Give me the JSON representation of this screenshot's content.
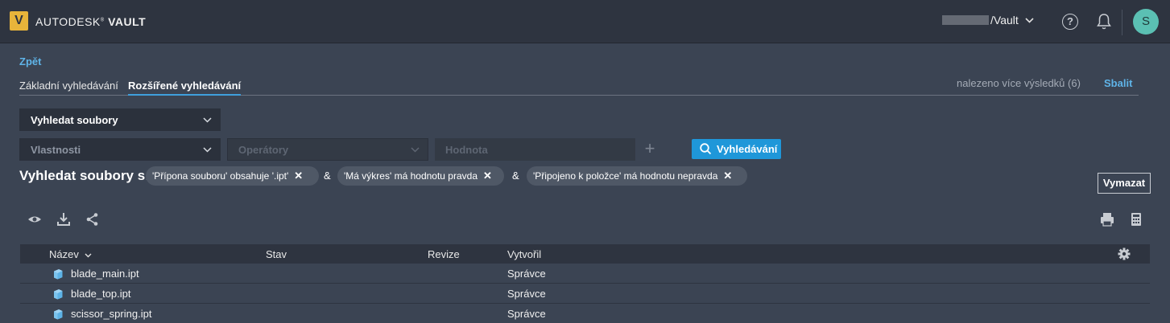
{
  "topbar": {
    "logo_letter": "V",
    "brand_prefix": "AUTODESK",
    "brand_name": "VAULT",
    "vault_name": "/Vault",
    "help_icon": "help-circle-icon",
    "bell_icon": "bell-icon",
    "user_initial": "S",
    "accent": "#e8b43a",
    "avatar_color": "#5bc0b3"
  },
  "nav": {
    "back_label": "Zpět"
  },
  "tabs": {
    "basic": "Základní vyhledávání",
    "advanced": "Rozšířené vyhledávání",
    "results_count": "nalezeno více výsledků (6)",
    "collapse": "Sbalit"
  },
  "search_form": {
    "search_type": "Vyhledat soubory",
    "properties_placeholder": "Vlastnosti",
    "operators_placeholder": "Operátory",
    "value_placeholder": "Hodnota",
    "add_symbol": "+",
    "search_button": "Vyhledávání"
  },
  "filters": {
    "label": "Vyhledat soubory s:",
    "chips": [
      "'Přípona souboru' obsahuje '.ipt'",
      "'Má výkres' má hodnotu pravda",
      "'Připojeno k položce' má hodnotu nepravda"
    ],
    "joiner": "&",
    "remove_symbol": "✕",
    "clear_button": "Vymazat"
  },
  "toolbar": {
    "icons": [
      "eye-icon",
      "download-icon",
      "share-icon",
      "print-icon",
      "calculator-icon"
    ]
  },
  "table": {
    "columns": [
      "Název",
      "Stav",
      "Revize",
      "Vytvořil"
    ],
    "sort_indicator": "⌄",
    "rows": [
      {
        "name": "blade_main.ipt",
        "state": "",
        "revision": "",
        "created_by": "Správce"
      },
      {
        "name": "blade_top.ipt",
        "state": "",
        "revision": "",
        "created_by": "Správce"
      },
      {
        "name": "scissor_spring.ipt",
        "state": "",
        "revision": "",
        "created_by": "Správce"
      }
    ]
  }
}
